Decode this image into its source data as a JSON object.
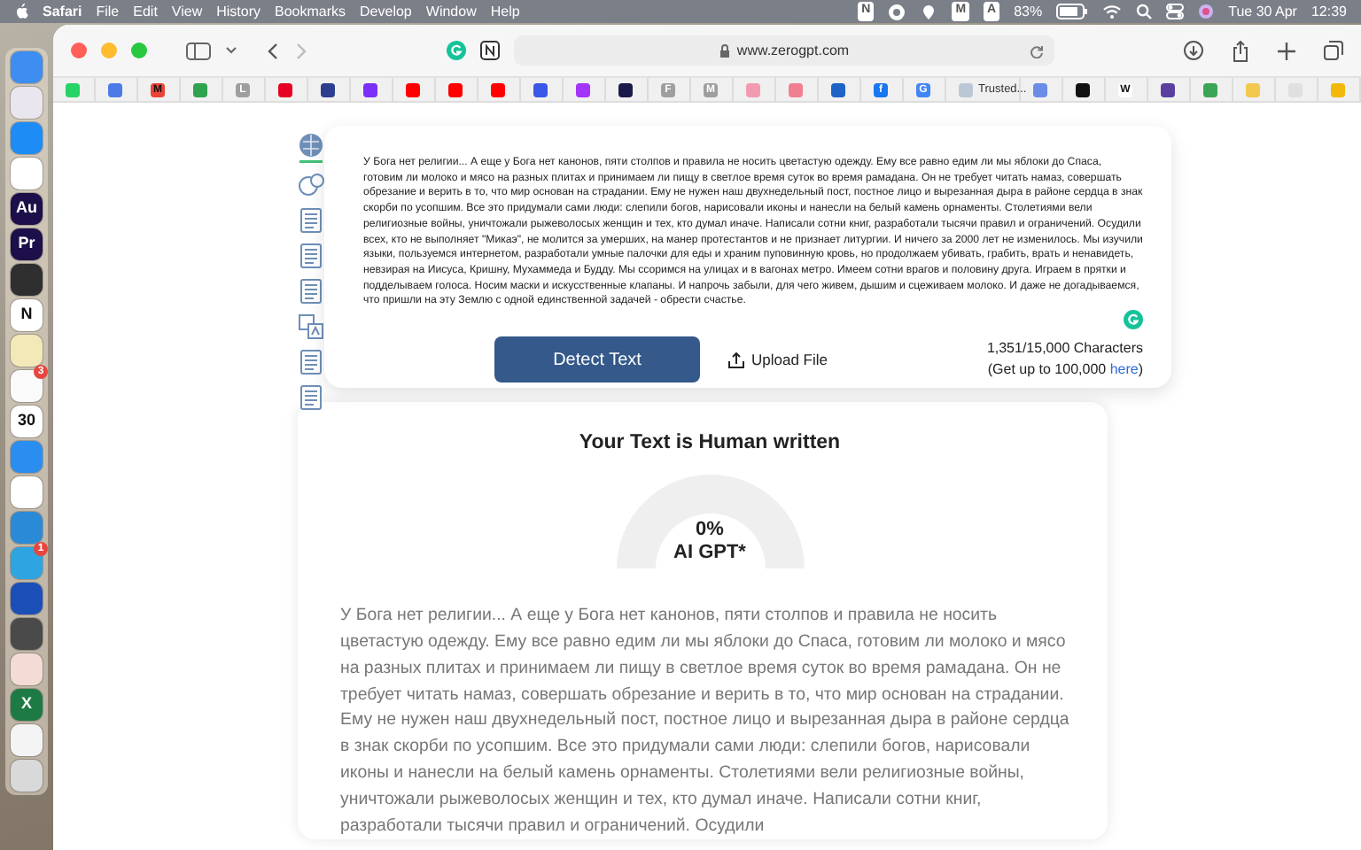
{
  "menu_bar": {
    "app": "Safari",
    "menus": [
      "File",
      "Edit",
      "View",
      "History",
      "Bookmarks",
      "Develop",
      "Window",
      "Help"
    ],
    "status_items": [
      {
        "kind": "letter",
        "text": "N"
      },
      {
        "kind": "circle"
      },
      {
        "kind": "pin"
      },
      {
        "kind": "letter",
        "text": "M"
      },
      {
        "kind": "letter",
        "text": "A"
      }
    ],
    "battery": {
      "text": "83%",
      "level": 0.83
    },
    "date": "Tue 30 Apr",
    "time": "12:39"
  },
  "dock": [
    {
      "color": "#3d8ef0"
    },
    {
      "color": "#e9e6ef"
    },
    {
      "color": "#1d8df5"
    },
    {
      "color": "#ffffff"
    },
    {
      "color": "#1d0f4a",
      "label": "Au"
    },
    {
      "color": "#1d0f4a",
      "label": "Pr"
    },
    {
      "color": "#2f2f2f"
    },
    {
      "color": "#ffffff",
      "label": "N"
    },
    {
      "color": "#f3e9b8"
    },
    {
      "color": "#fafafa",
      "badge": "3"
    },
    {
      "color": "#ffffff",
      "label": "30"
    },
    {
      "color": "#2a8ef0"
    },
    {
      "color": "#ffffff"
    },
    {
      "color": "#2b8ad8"
    },
    {
      "color": "#2ea5e0",
      "badge": "1"
    },
    {
      "color": "#1b4fb7"
    },
    {
      "color": "#4a4a4a"
    },
    {
      "color": "#f4dcd6"
    },
    {
      "color": "#1e7a44",
      "label": "X"
    },
    {
      "color": "#f4f4f4"
    },
    {
      "color": "#d9d9d9"
    }
  ],
  "browser": {
    "url": "www.zerogpt.com",
    "bookmarks": [
      {
        "color": "#25d366"
      },
      {
        "color": "#4c7be8"
      },
      {
        "color": "#ea4335",
        "letter": "M"
      },
      {
        "color": "#2ea44f"
      },
      {
        "color": "#9e9e9e",
        "letter": "L"
      },
      {
        "color": "#e60023"
      },
      {
        "color": "#2c3e8f"
      },
      {
        "color": "#7b2ff7"
      },
      {
        "color": "#ff0000"
      },
      {
        "color": "#ff0000"
      },
      {
        "color": "#ff0000"
      },
      {
        "color": "#3a57e8"
      },
      {
        "color": "#a334fa"
      },
      {
        "color": "#1a1a4a"
      },
      {
        "color": "#9e9e9e",
        "letter": "F"
      },
      {
        "color": "#9e9e9e",
        "letter": "M"
      },
      {
        "color": "#f29bb0"
      },
      {
        "color": "#f07f8f"
      },
      {
        "color": "#1e63c6"
      },
      {
        "color": "#1877f2",
        "letter": "f"
      },
      {
        "color": "#4285f4",
        "letter": "G"
      },
      {
        "color": "#bcc7d6",
        "title": "Trusted..."
      },
      {
        "color": "#6b8de8"
      },
      {
        "color": "#111111"
      },
      {
        "color": "#ffffff",
        "letter": "W"
      },
      {
        "color": "#5b3fa0"
      },
      {
        "color": "#3aa655"
      },
      {
        "color": "#f2c94c"
      },
      {
        "color": "#e0e0e0"
      },
      {
        "color": "#f2b90c"
      }
    ]
  },
  "tools": [
    {
      "kind": "brain",
      "selected": true
    },
    {
      "kind": "chat",
      "selected": false
    },
    {
      "kind": "document",
      "selected": false
    },
    {
      "kind": "document",
      "selected": false
    },
    {
      "kind": "document",
      "selected": false
    },
    {
      "kind": "translate",
      "selected": false
    },
    {
      "kind": "document",
      "selected": false
    },
    {
      "kind": "document",
      "selected": false
    }
  ],
  "input": {
    "text": "У Бога нет религии... А еще у Бога нет канонов, пяти столпов и правила не носить цветастую одежду. Ему все равно едим ли мы яблоки до Спаса, готовим ли молоко и мясо на разных плитах и принимаем ли пищу в светлое время суток во время рамадана. Он не требует читать намаз, совершать обрезание и верить в то, что мир основан на страдании. Ему не нужен наш двухнедельный пост, постное лицо и вырезанная дыра в районе сердца в знак скорби по усопшим. Все это придумали сами люди: слепили богов, нарисовали иконы и нанесли на белый камень орнаменты. Столетиями вели религиозные войны, уничтожали рыжеволосых женщин и тех, кто думал иначе. Написали сотни книг, разработали тысячи правил и ограничений. Осудили всех, кто не выполняет \"Микаэ\", не молится за умерших, на манер протестантов и не признает литургии. И ничего за 2000 лет не изменилось. Мы изучили языки, пользуемся интернетом, разработали умные палочки для еды и храним пуповинную кровь, но продолжаем убивать, грабить, врать и ненавидеть, невзирая на Иисуса, Кришну, Мухаммеда и Будду. Мы ссоримся на улицах и в вагонах метро. Имеем сотни врагов и половину друга. Играем в прятки и подделываем голоса. Носим маски и искусственные клапаны. И напрочь забыли, для чего живем, дышим и сцеживаем молоко. И даже не догадываемся, что пришли на эту Землю с одной единственной задачей - обрести счастье.",
    "detect_button": "Detect Text",
    "upload_button": "Upload File",
    "count": "1,351/15,000 Characters",
    "limit_note": {
      "before": "(Get up to 100,000 ",
      "link": "here",
      "after": ")"
    }
  },
  "result": {
    "heading": "Your Text is Human written",
    "gauge": {
      "value": "0%",
      "label": "AI GPT*"
    },
    "text": "У Бога нет религии... А еще у Бога нет канонов, пяти столпов и правила не носить цветастую одежду. Ему все равно едим ли мы яблоки до Спаса, готовим ли молоко и мясо на разных плитах и принимаем ли пищу в светлое время суток во время рамадана. Он не требует читать намаз, совершать обрезание и верить в то, что мир основан на страдании. Ему не нужен наш двухнедельный пост, постное лицо и вырезанная дыра в районе сердца в знак скорби по усопшим. Все это придумали сами люди: слепили богов, нарисовали иконы и нанесли на белый камень орнаменты. Столетиями вели религиозные войны, уничтожали рыжеволосых женщин и тех, кто думал иначе. Написали сотни книг, разработали тысячи правил и ограничений. Осудили"
  }
}
